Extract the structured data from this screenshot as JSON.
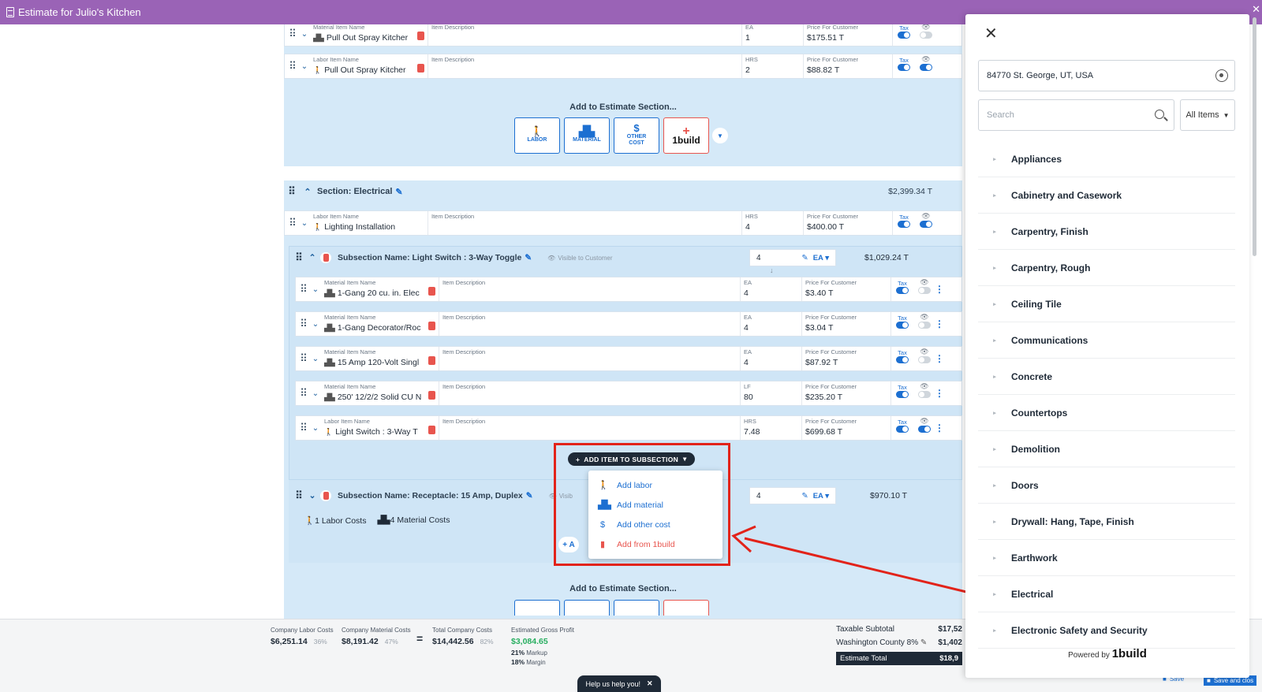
{
  "app": {
    "title": "Estimate for Julio's Kitchen"
  },
  "top_items": [
    {
      "type_label": "Material Item Name",
      "name": "Pull Out Spray Kitcher",
      "desc_label": "Item Description",
      "unit_label": "EA",
      "qty": "1",
      "price_label": "Price For Customer",
      "price": "$175.51 T",
      "tax_label": "Tax",
      "tax_on": true,
      "visible_on": false
    },
    {
      "type_label": "Labor Item Name",
      "name": "Pull Out Spray Kitcher",
      "desc_label": "Item Description",
      "unit_label": "HRS",
      "qty": "2",
      "price_label": "Price For Customer",
      "price": "$88.82 T",
      "tax_label": "Tax",
      "tax_on": true,
      "visible_on": true
    }
  ],
  "add_section": {
    "title": "Add to Estimate Section...",
    "labor": "LABOR",
    "material": "MATERIAL",
    "other_cost_1": "OTHER",
    "other_cost_2": "COST",
    "onebuild": "1build"
  },
  "electrical": {
    "title": "Section: Electrical",
    "total": "$2,399.34 T",
    "labor_row": {
      "type_label": "Labor Item Name",
      "name": "Lighting Installation",
      "desc_label": "Item Description",
      "unit_label": "HRS",
      "qty": "4",
      "price_label": "Price For Customer",
      "price": "$400.00 T",
      "tax_label": "Tax"
    }
  },
  "subsection1": {
    "name": "Subsection Name: Light Switch : 3-Way Toggle",
    "visible": "Visible to Customer",
    "qty": "4",
    "unit": "EA",
    "total": "$1,029.24 T",
    "items": [
      {
        "type_label": "Material Item Name",
        "name": "1-Gang 20 cu. in. Elec",
        "desc_label": "Item Description",
        "unit_label": "EA",
        "qty": "4",
        "price_label": "Price For Customer",
        "price": "$3.40 T",
        "tax_label": "Tax",
        "visible_on": false
      },
      {
        "type_label": "Material Item Name",
        "name": "1-Gang Decorator/Roc",
        "desc_label": "Item Description",
        "unit_label": "EA",
        "qty": "4",
        "price_label": "Price For Customer",
        "price": "$3.04 T",
        "tax_label": "Tax",
        "visible_on": false
      },
      {
        "type_label": "Material Item Name",
        "name": "15 Amp 120-Volt Singl",
        "desc_label": "Item Description",
        "unit_label": "EA",
        "qty": "4",
        "price_label": "Price For Customer",
        "price": "$87.92 T",
        "tax_label": "Tax",
        "visible_on": false
      },
      {
        "type_label": "Material Item Name",
        "name": "250' 12/2/2 Solid CU N",
        "desc_label": "Item Description",
        "unit_label": "LF",
        "qty": "80",
        "price_label": "Price For Customer",
        "price": "$235.20 T",
        "tax_label": "Tax",
        "visible_on": false
      },
      {
        "type_label": "Labor Item Name",
        "name": "Light Switch : 3-Way T",
        "desc_label": "Item Description",
        "unit_label": "HRS",
        "qty": "7.48",
        "price_label": "Price For Customer",
        "price": "$699.68 T",
        "tax_label": "Tax",
        "visible_on": true
      }
    ],
    "add_item_label": "ADD ITEM TO SUBSECTION"
  },
  "add_menu": {
    "items": [
      {
        "label": "Add labor"
      },
      {
        "label": "Add material"
      },
      {
        "label": "Add other cost"
      },
      {
        "label": "Add from 1build"
      }
    ]
  },
  "subsection2": {
    "name": "Subsection Name: Receptacle: 15 Amp, Duplex",
    "visible": "Visib",
    "qty": "4",
    "unit": "EA",
    "total": "$970.10 T",
    "labor_costs": "1 Labor Costs",
    "material_costs": "4 Material Costs",
    "add_partial": "+ A"
  },
  "add_section_2": {
    "title": "Add to Estimate Section..."
  },
  "summary": {
    "company_labor_label": "Company Labor Costs",
    "company_labor": "$6,251.14",
    "company_labor_pct": "36%",
    "company_material_label": "Company Material Costs",
    "company_material": "$8,191.42",
    "company_material_pct": "47%",
    "equals": "=",
    "total_company_label": "Total Company Costs",
    "total_company": "$14,442.56",
    "total_company_pct": "82%",
    "gross_profit_label": "Estimated Gross Profit",
    "gross_profit": "$3,084.65",
    "markup": "21%",
    "markup_label": "Markup",
    "margin": "18%",
    "margin_label": "Margin",
    "taxable_subtotal_label": "Taxable Subtotal",
    "taxable_subtotal": "$17,52",
    "county_tax_label": "Washington County 8%",
    "county_tax": "$1,402",
    "estimate_total_label": "Estimate Total",
    "estimate_total": "$18,9",
    "save_label": "Save",
    "save_close_label": "Save and clos"
  },
  "help": {
    "label": "Help us help you!"
  },
  "drawer": {
    "location": "84770 St. George, UT, USA",
    "search_placeholder": "Search",
    "filter": "All Items",
    "categories": [
      "Appliances",
      "Cabinetry and Casework",
      "Carpentry, Finish",
      "Carpentry, Rough",
      "Ceiling Tile",
      "Communications",
      "Concrete",
      "Countertops",
      "Demolition",
      "Doors",
      "Drywall: Hang, Tape, Finish",
      "Earthwork",
      "Electrical",
      "Electronic Safety and Security"
    ],
    "powered_by": "Powered by",
    "brand": "1build"
  },
  "colors": {
    "accent": "#1c6fd1",
    "header": "#9a63b6",
    "annotation": "#e2231a",
    "brand": "#e8554e"
  }
}
